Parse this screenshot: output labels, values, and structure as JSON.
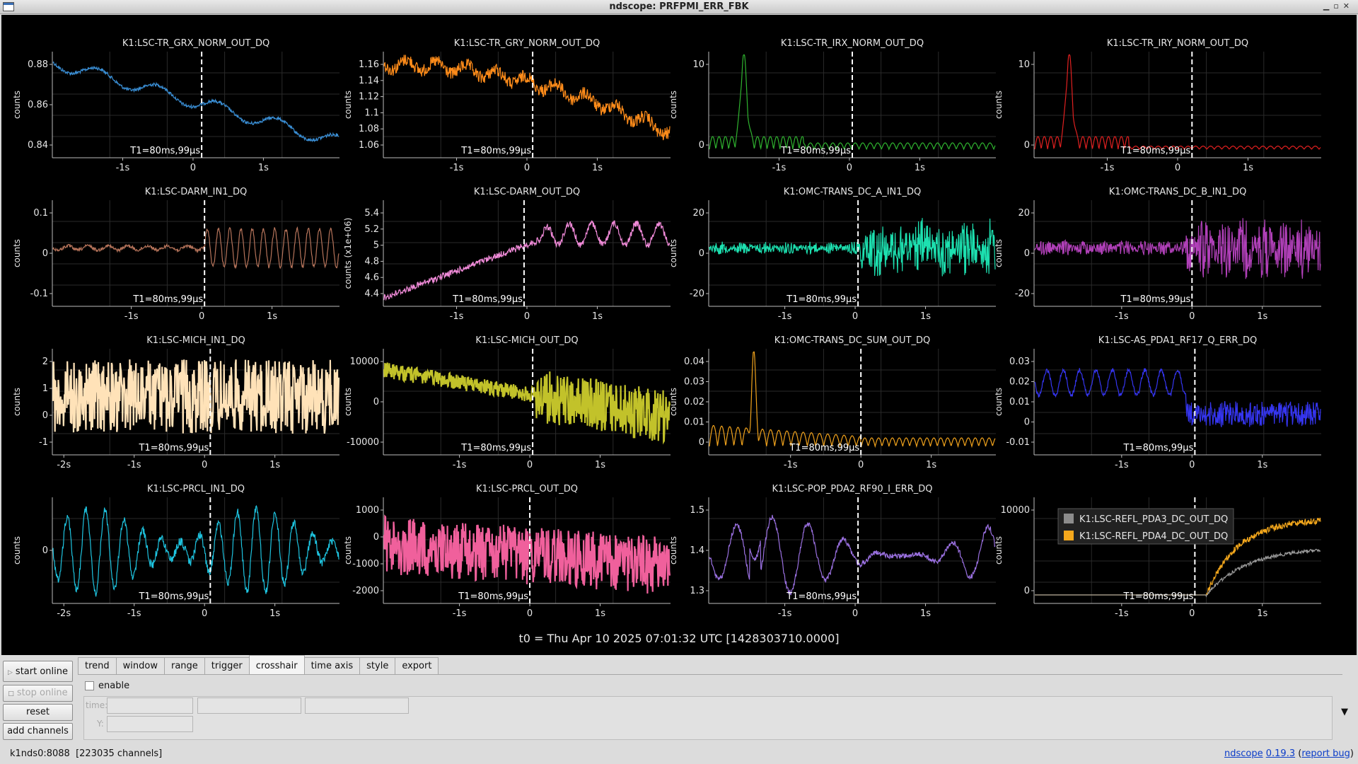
{
  "window": {
    "title": "ndscope: PRFPMI_ERR_FBK"
  },
  "t0_label": "t0 = Thu Apr 10 2025 07:01:32 UTC [1428303710.0000]",
  "cursor_label": "T1=80ms,99µs",
  "plots": [
    {
      "title": "K1:LSC-TR_GRX_NORM_OUT_DQ",
      "ylabel": "counts",
      "color": "#3a8fd6",
      "yticks": [
        "0.88",
        "0.86",
        "0.84"
      ],
      "xticks": [
        "-1s",
        "0",
        "1s"
      ]
    },
    {
      "title": "K1:LSC-TR_GRY_NORM_OUT_DQ",
      "ylabel": "counts",
      "color": "#ff8c1a",
      "yticks": [
        "1.16",
        "1.14",
        "1.12",
        "1.1",
        "1.08",
        "1.06"
      ],
      "xticks": [
        "-1s",
        "0",
        "1s"
      ]
    },
    {
      "title": "K1:LSC-TR_IRX_NORM_OUT_DQ",
      "ylabel": "counts",
      "color": "#2fb32f",
      "yticks": [
        "10",
        "0"
      ],
      "xticks": [
        "-1s",
        "0",
        "1s"
      ]
    },
    {
      "title": "K1:LSC-TR_IRY_NORM_OUT_DQ",
      "ylabel": "counts",
      "color": "#e02020",
      "yticks": [
        "10",
        "0"
      ],
      "xticks": [
        "-1s",
        "0",
        "1s"
      ]
    },
    {
      "title": "K1:LSC-DARM_IN1_DQ",
      "ylabel": "counts",
      "color": "#b5735a",
      "yticks": [
        "0.1",
        "0",
        "-0.1"
      ],
      "xticks": [
        "-1s",
        "0",
        "1s"
      ]
    },
    {
      "title": "K1:LSC-DARM_OUT_DQ",
      "ylabel": "counts (x1e+06)",
      "color": "#f08ad8",
      "yticks": [
        "5.4",
        "5.2",
        "5",
        "4.8",
        "4.6",
        "4.4"
      ],
      "xticks": [
        "-1s",
        "0",
        "1s"
      ]
    },
    {
      "title": "K1:OMC-TRANS_DC_A_IN1_DQ",
      "ylabel": "counts",
      "color": "#1de0b0",
      "yticks": [
        "20",
        "0",
        "-20"
      ],
      "xticks": [
        "-1s",
        "0",
        "1s"
      ]
    },
    {
      "title": "K1:OMC-TRANS_DC_B_IN1_DQ",
      "ylabel": "counts",
      "color": "#b040b8",
      "yticks": [
        "20",
        "0",
        "-20"
      ],
      "xticks": [
        "-1s",
        "0",
        "1s"
      ]
    },
    {
      "title": "K1:LSC-MICH_IN1_DQ",
      "ylabel": "counts",
      "color": "#ffe2b8",
      "yticks": [
        "2",
        "1",
        "0",
        "-1"
      ],
      "xticks": [
        "-2s",
        "-1s",
        "0",
        "1s"
      ]
    },
    {
      "title": "K1:LSC-MICH_OUT_DQ",
      "ylabel": "counts",
      "color": "#c2c22a",
      "yticks": [
        "10000",
        "0",
        "-10000"
      ],
      "xticks": [
        "-1s",
        "0",
        "1s"
      ]
    },
    {
      "title": "K1:OMC-TRANS_DC_SUM_OUT_DQ",
      "ylabel": "counts",
      "color": "#f0a21c",
      "yticks": [
        "0.04",
        "0.03",
        "0.02",
        "0.01",
        "0"
      ],
      "xticks": [
        "-1s",
        "0",
        "1s"
      ]
    },
    {
      "title": "K1:LSC-AS_PDA1_RF17_Q_ERR_DQ",
      "ylabel": "counts",
      "color": "#3535f0",
      "yticks": [
        "0.03",
        "0.02",
        "0.01",
        "0",
        "-0.01"
      ],
      "xticks": [
        "-1s",
        "0",
        "1s"
      ]
    },
    {
      "title": "K1:LSC-PRCL_IN1_DQ",
      "ylabel": "counts",
      "color": "#1ec4e0",
      "yticks": [
        "0"
      ],
      "xticks": [
        "-2s",
        "-1s",
        "0",
        "1s"
      ]
    },
    {
      "title": "K1:LSC-PRCL_OUT_DQ",
      "ylabel": "counts",
      "color": "#f0609c",
      "yticks": [
        "1000",
        "0",
        "-1000",
        "-2000"
      ],
      "xticks": [
        "-1s",
        "0",
        "1s"
      ]
    },
    {
      "title": "K1:LSC-POP_PDA2_RF90_I_ERR_DQ",
      "ylabel": "counts",
      "color": "#9a70e0",
      "yticks": [
        "1.5",
        "1.4",
        "1.3"
      ],
      "xticks": [
        "-1s",
        "0",
        "1s"
      ]
    },
    {
      "title": "",
      "ylabel": "counts",
      "color": "#f5a81c",
      "yticks": [
        "10000",
        "0"
      ],
      "xticks": [
        "-1s",
        "0",
        "1s"
      ],
      "legend": [
        {
          "name": "K1:LSC-REFL_PDA3_DC_OUT_DQ",
          "color": "#8c8c8c"
        },
        {
          "name": "K1:LSC-REFL_PDA4_DC_OUT_DQ",
          "color": "#f5a81c"
        }
      ]
    }
  ],
  "sidebar": {
    "start_online": "start online",
    "stop_online": "stop online",
    "reset": "reset",
    "add_channels": "add channels"
  },
  "tabs": [
    "trend",
    "window",
    "range",
    "trigger",
    "crosshair",
    "time axis",
    "style",
    "export"
  ],
  "active_tab": "crosshair",
  "crosshair": {
    "enable_label": "enable",
    "time_label": "time:",
    "y_label": "Y:"
  },
  "status": {
    "server": "k1nds0:8088",
    "channels": "[223035 channels]",
    "app_name": "ndscope",
    "version": "0.19.3",
    "report_bug": "report bug"
  }
}
